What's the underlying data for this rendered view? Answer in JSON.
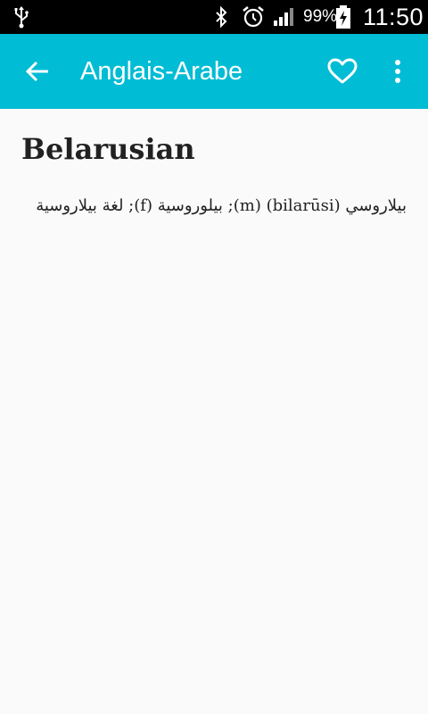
{
  "status_bar": {
    "battery_pct": "99%",
    "time": "11:50",
    "icons": [
      "usb-icon",
      "bluetooth-icon",
      "alarm-icon",
      "signal-icon",
      "battery-charging-icon"
    ]
  },
  "app_bar": {
    "title": "Anglais-Arabe",
    "color": "#00bcd4",
    "icons": [
      "back-arrow-icon",
      "heart-icon",
      "more-vert-icon"
    ]
  },
  "entry": {
    "word": "Belarusian",
    "definition": "بيلاروسي (bilarūsi) (m); بيلوروسية (f); لغة بيلاروسية"
  }
}
